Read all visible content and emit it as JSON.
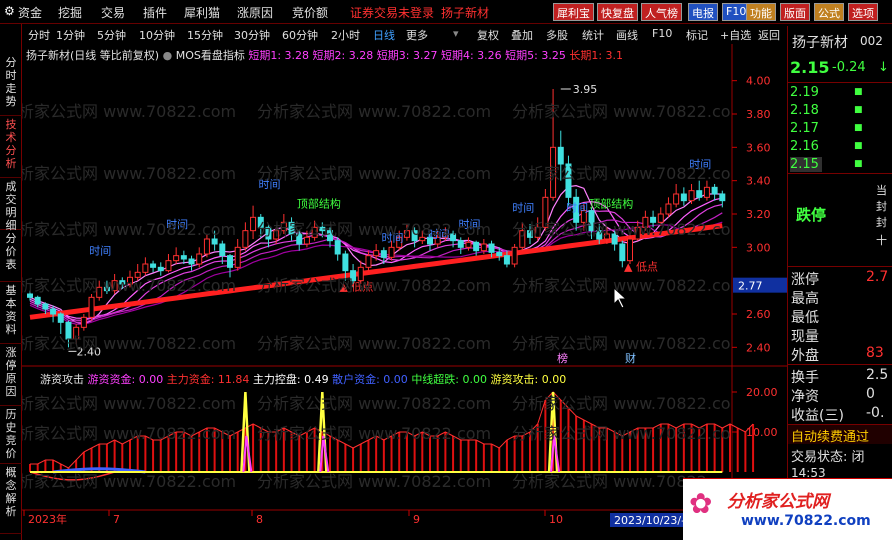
{
  "menubar": {
    "items": [
      "资金",
      "挖掘",
      "交易",
      "插件",
      "犀利猫",
      "涨原因",
      "竞价额"
    ],
    "warning": "证券交易未登录",
    "stock_name": "扬子新材",
    "buttons": [
      "犀利宝",
      "快复盘",
      "人气榜",
      "电报",
      "F10",
      "功能",
      "版面",
      "公式",
      "选项"
    ],
    "button_colors": [
      "#c02020",
      "#c02020",
      "#c02020",
      "#2050c0",
      "#2050c0",
      "#c08020",
      "#c02020",
      "#c08020",
      "#c02020"
    ]
  },
  "left_icon": "settings-gear-icon",
  "side_tabs": [
    "分时走势",
    "技术分析",
    "成交明细",
    "分价表",
    "基本资料",
    "涨停原因",
    "历史竞价",
    "概念解析"
  ],
  "toolbar": {
    "periods": [
      "分时",
      "1分钟",
      "5分钟",
      "10分钟",
      "15分钟",
      "30分钟",
      "60分钟",
      "2小时",
      "日线",
      "更多"
    ],
    "selected": "日线",
    "tools": [
      "复权",
      "叠加",
      "多股",
      "统计",
      "画线",
      "F10",
      "标记",
      "+自选",
      "返回"
    ]
  },
  "main_legend": {
    "title": "扬子新材(日线 等比前复权)",
    "indicator": "MOS看盘指标",
    "items": [
      {
        "label": "短期1: 3.28",
        "color": "#ff40ff"
      },
      {
        "label": "短期2: 3.28",
        "color": "#ff40ff"
      },
      {
        "label": "短期3: 3.27",
        "color": "#ff40ff"
      },
      {
        "label": "短期4: 3.26",
        "color": "#ff40ff"
      },
      {
        "label": "短期5: 3.25",
        "color": "#ff40ff"
      },
      {
        "label": "长期1: 3.1",
        "color": "#ff3030"
      }
    ]
  },
  "price_axis": [
    "4.00",
    "3.80",
    "3.60",
    "3.40",
    "3.20",
    "3.00",
    "2.60",
    "2.40"
  ],
  "current_price_tag": "2.77",
  "annotations": {
    "high": "3.95",
    "low": "2.40",
    "shijian": "时间",
    "dingbu": "顶部结构",
    "didian": "低点",
    "bang": "榜",
    "cai": "财"
  },
  "sub_legend": {
    "title": "游资攻击",
    "items": [
      {
        "label": "游资资金: 0.00",
        "color": "#ff40ff"
      },
      {
        "label": "主力资金: 11.84",
        "color": "#ff3030"
      },
      {
        "label": "主力控盘: 0.49",
        "color": "#ffffff"
      },
      {
        "label": "散户资金: 0.00",
        "color": "#4060ff"
      },
      {
        "label": "中线超跌: 0.00",
        "color": "#40ff40"
      },
      {
        "label": "游资攻击: 0.00",
        "color": "#ffff40"
      }
    ]
  },
  "sub_axis": [
    "20.00",
    "10.00"
  ],
  "date_axis": [
    "2023年",
    "7",
    "8",
    "9",
    "10"
  ],
  "date_tag": "2023/10/23/-",
  "watermark_text": "分析家公式网 www.70822.com",
  "right_panel": {
    "name": "扬子新材",
    "code": "002",
    "price": "2.15",
    "change": "-0.24",
    "change_arrow": "↓",
    "book": [
      "2.19",
      "2.18",
      "2.17",
      "2.16",
      "2.15"
    ],
    "limit_status": "跌停",
    "side_glyphs": [
      "当",
      "封",
      "封",
      "十"
    ],
    "fields": [
      {
        "label": "涨停",
        "value": "2.7"
      },
      {
        "label": "最高",
        "value": ""
      },
      {
        "label": "最低",
        "value": ""
      },
      {
        "label": "现量",
        "value": ""
      },
      {
        "label": "外盘",
        "value": "83"
      },
      {
        "label": "换手",
        "value": "2.5"
      },
      {
        "label": "净资",
        "value": "0"
      },
      {
        "label": "收益(三)",
        "value": "-0."
      }
    ],
    "notice": "自动续费通过",
    "trade_status": "交易状态: 闭",
    "time": "14:53"
  },
  "logo": {
    "title": "分析家公式网",
    "url": "www.70822.com"
  },
  "chart_data": {
    "type": "candlestick",
    "price_ylim": [
      2.3,
      4.1
    ],
    "candles": [
      {
        "o": 2.72,
        "c": 2.7,
        "h": 2.74,
        "l": 2.68
      },
      {
        "o": 2.7,
        "c": 2.66,
        "h": 2.71,
        "l": 2.64
      },
      {
        "o": 2.66,
        "c": 2.63,
        "h": 2.67,
        "l": 2.6
      },
      {
        "o": 2.63,
        "c": 2.6,
        "h": 2.65,
        "l": 2.55
      },
      {
        "o": 2.6,
        "c": 2.55,
        "h": 2.61,
        "l": 2.48
      },
      {
        "o": 2.55,
        "c": 2.45,
        "h": 2.56,
        "l": 2.4
      },
      {
        "o": 2.45,
        "c": 2.52,
        "h": 2.54,
        "l": 2.42
      },
      {
        "o": 2.52,
        "c": 2.58,
        "h": 2.6,
        "l": 2.5
      },
      {
        "o": 2.58,
        "c": 2.7,
        "h": 2.72,
        "l": 2.56
      },
      {
        "o": 2.7,
        "c": 2.76,
        "h": 2.8,
        "l": 2.68
      },
      {
        "o": 2.76,
        "c": 2.74,
        "h": 2.8,
        "l": 2.72
      },
      {
        "o": 2.74,
        "c": 2.8,
        "h": 2.84,
        "l": 2.72
      },
      {
        "o": 2.8,
        "c": 2.78,
        "h": 2.82,
        "l": 2.75
      },
      {
        "o": 2.78,
        "c": 2.82,
        "h": 2.86,
        "l": 2.76
      },
      {
        "o": 2.82,
        "c": 2.85,
        "h": 2.9,
        "l": 2.8
      },
      {
        "o": 2.85,
        "c": 2.9,
        "h": 2.94,
        "l": 2.83
      },
      {
        "o": 2.9,
        "c": 2.88,
        "h": 2.92,
        "l": 2.85
      },
      {
        "o": 2.88,
        "c": 2.86,
        "h": 2.91,
        "l": 2.83
      },
      {
        "o": 2.86,
        "c": 2.92,
        "h": 2.96,
        "l": 2.85
      },
      {
        "o": 2.92,
        "c": 2.95,
        "h": 3.0,
        "l": 2.9
      },
      {
        "o": 2.95,
        "c": 2.93,
        "h": 2.98,
        "l": 2.9
      },
      {
        "o": 2.93,
        "c": 2.9,
        "h": 2.95,
        "l": 2.86
      },
      {
        "o": 2.9,
        "c": 2.96,
        "h": 3.0,
        "l": 2.88
      },
      {
        "o": 2.96,
        "c": 3.05,
        "h": 3.08,
        "l": 2.94
      },
      {
        "o": 3.05,
        "c": 3.02,
        "h": 3.1,
        "l": 2.98
      },
      {
        "o": 3.02,
        "c": 2.95,
        "h": 3.04,
        "l": 2.9
      },
      {
        "o": 2.95,
        "c": 2.88,
        "h": 2.96,
        "l": 2.82
      },
      {
        "o": 2.88,
        "c": 3.0,
        "h": 3.05,
        "l": 2.86
      },
      {
        "o": 3.0,
        "c": 3.1,
        "h": 3.15,
        "l": 2.98
      },
      {
        "o": 3.1,
        "c": 3.18,
        "h": 3.25,
        "l": 3.05
      },
      {
        "o": 3.18,
        "c": 3.12,
        "h": 3.2,
        "l": 3.06
      },
      {
        "o": 3.12,
        "c": 3.05,
        "h": 3.14,
        "l": 3.0
      },
      {
        "o": 3.05,
        "c": 3.1,
        "h": 3.12,
        "l": 3.02
      },
      {
        "o": 3.1,
        "c": 3.15,
        "h": 3.2,
        "l": 3.08
      },
      {
        "o": 3.15,
        "c": 3.08,
        "h": 3.18,
        "l": 3.04
      },
      {
        "o": 3.08,
        "c": 3.02,
        "h": 3.1,
        "l": 2.98
      },
      {
        "o": 3.02,
        "c": 3.06,
        "h": 3.1,
        "l": 3.0
      },
      {
        "o": 3.06,
        "c": 3.12,
        "h": 3.16,
        "l": 3.04
      },
      {
        "o": 3.12,
        "c": 3.1,
        "h": 3.15,
        "l": 3.06
      },
      {
        "o": 3.1,
        "c": 3.04,
        "h": 3.12,
        "l": 3.0
      },
      {
        "o": 3.04,
        "c": 2.96,
        "h": 3.06,
        "l": 2.92
      },
      {
        "o": 2.96,
        "c": 2.86,
        "h": 2.98,
        "l": 2.8
      },
      {
        "o": 2.86,
        "c": 2.8,
        "h": 2.9,
        "l": 2.76
      },
      {
        "o": 2.8,
        "c": 2.88,
        "h": 2.92,
        "l": 2.78
      },
      {
        "o": 2.88,
        "c": 2.95,
        "h": 2.98,
        "l": 2.86
      },
      {
        "o": 2.95,
        "c": 2.98,
        "h": 3.02,
        "l": 2.92
      },
      {
        "o": 2.98,
        "c": 2.94,
        "h": 3.0,
        "l": 2.9
      },
      {
        "o": 2.94,
        "c": 3.0,
        "h": 3.04,
        "l": 2.92
      },
      {
        "o": 3.0,
        "c": 3.06,
        "h": 3.1,
        "l": 2.98
      },
      {
        "o": 3.06,
        "c": 3.1,
        "h": 3.14,
        "l": 3.04
      },
      {
        "o": 3.1,
        "c": 3.04,
        "h": 3.12,
        "l": 3.0
      },
      {
        "o": 3.04,
        "c": 3.06,
        "h": 3.1,
        "l": 3.02
      },
      {
        "o": 3.06,
        "c": 3.02,
        "h": 3.08,
        "l": 2.98
      },
      {
        "o": 3.02,
        "c": 3.06,
        "h": 3.1,
        "l": 3.0
      },
      {
        "o": 3.06,
        "c": 3.08,
        "h": 3.12,
        "l": 3.04
      },
      {
        "o": 3.08,
        "c": 3.04,
        "h": 3.1,
        "l": 3.0
      },
      {
        "o": 3.04,
        "c": 3.0,
        "h": 3.06,
        "l": 2.96
      },
      {
        "o": 3.0,
        "c": 3.03,
        "h": 3.06,
        "l": 2.98
      },
      {
        "o": 3.03,
        "c": 2.98,
        "h": 3.04,
        "l": 2.95
      },
      {
        "o": 2.98,
        "c": 3.02,
        "h": 3.05,
        "l": 2.96
      },
      {
        "o": 3.02,
        "c": 2.97,
        "h": 3.04,
        "l": 2.94
      },
      {
        "o": 2.97,
        "c": 2.95,
        "h": 3.0,
        "l": 2.92
      },
      {
        "o": 2.95,
        "c": 2.9,
        "h": 2.98,
        "l": 2.88
      },
      {
        "o": 2.9,
        "c": 3.0,
        "h": 3.02,
        "l": 2.88
      },
      {
        "o": 3.0,
        "c": 3.1,
        "h": 3.15,
        "l": 2.98
      },
      {
        "o": 3.1,
        "c": 3.06,
        "h": 3.14,
        "l": 3.02
      },
      {
        "o": 3.06,
        "c": 3.12,
        "h": 3.18,
        "l": 3.04
      },
      {
        "o": 3.12,
        "c": 3.3,
        "h": 3.35,
        "l": 3.1
      },
      {
        "o": 3.3,
        "c": 3.6,
        "h": 3.95,
        "l": 3.28
      },
      {
        "o": 3.6,
        "c": 3.5,
        "h": 3.7,
        "l": 3.4
      },
      {
        "o": 3.5,
        "c": 3.3,
        "h": 3.55,
        "l": 3.25
      },
      {
        "o": 3.3,
        "c": 3.15,
        "h": 3.35,
        "l": 3.1
      },
      {
        "o": 3.15,
        "c": 3.22,
        "h": 3.26,
        "l": 3.1
      },
      {
        "o": 3.22,
        "c": 3.1,
        "h": 3.24,
        "l": 3.05
      },
      {
        "o": 3.1,
        "c": 3.05,
        "h": 3.14,
        "l": 3.02
      },
      {
        "o": 3.05,
        "c": 3.08,
        "h": 3.12,
        "l": 3.02
      },
      {
        "o": 3.08,
        "c": 3.02,
        "h": 3.1,
        "l": 2.98
      },
      {
        "o": 3.02,
        "c": 2.92,
        "h": 3.04,
        "l": 2.88
      },
      {
        "o": 2.92,
        "c": 3.05,
        "h": 3.08,
        "l": 2.9
      },
      {
        "o": 3.05,
        "c": 3.12,
        "h": 3.16,
        "l": 3.04
      },
      {
        "o": 3.12,
        "c": 3.18,
        "h": 3.22,
        "l": 3.1
      },
      {
        "o": 3.18,
        "c": 3.15,
        "h": 3.22,
        "l": 3.12
      },
      {
        "o": 3.15,
        "c": 3.2,
        "h": 3.24,
        "l": 3.13
      },
      {
        "o": 3.2,
        "c": 3.26,
        "h": 3.3,
        "l": 3.18
      },
      {
        "o": 3.26,
        "c": 3.32,
        "h": 3.38,
        "l": 3.24
      },
      {
        "o": 3.32,
        "c": 3.28,
        "h": 3.36,
        "l": 3.25
      },
      {
        "o": 3.28,
        "c": 3.34,
        "h": 3.38,
        "l": 3.26
      },
      {
        "o": 3.34,
        "c": 3.3,
        "h": 3.4,
        "l": 3.28
      },
      {
        "o": 3.3,
        "c": 3.36,
        "h": 3.4,
        "l": 3.28
      },
      {
        "o": 3.36,
        "c": 3.32,
        "h": 3.38,
        "l": 3.28
      },
      {
        "o": 3.32,
        "c": 3.28,
        "h": 3.34,
        "l": 3.24
      }
    ],
    "sub_ylim": [
      -3,
      22
    ],
    "main_fund": [
      2,
      2,
      3,
      3,
      2,
      1,
      3,
      5,
      6,
      7,
      7,
      8,
      7,
      8,
      9,
      9,
      8,
      8,
      9,
      10,
      10,
      9,
      10,
      11,
      11,
      10,
      9,
      10,
      11,
      12,
      11,
      10,
      10,
      11,
      10,
      9,
      10,
      11,
      10,
      9,
      8,
      7,
      6,
      7,
      8,
      9,
      8,
      9,
      10,
      10,
      9,
      10,
      9,
      9,
      10,
      9,
      8,
      8,
      8,
      7,
      7,
      6,
      8,
      9,
      9,
      10,
      12,
      18,
      20,
      18,
      16,
      14,
      13,
      12,
      11,
      11,
      10,
      9,
      10,
      11,
      11,
      11,
      12,
      12,
      11,
      12,
      12,
      11,
      12,
      12,
      11,
      12,
      11,
      10,
      12
    ],
    "attack": [
      0,
      0,
      0,
      0,
      0,
      0,
      0,
      0,
      0,
      0,
      0,
      0,
      0,
      0,
      0,
      0,
      0,
      0,
      0,
      0,
      0,
      0,
      0,
      0,
      0,
      0,
      0,
      0,
      0,
      0,
      0,
      0,
      0,
      0,
      0,
      0,
      0,
      0,
      0,
      0,
      0,
      0,
      0,
      0,
      0,
      0,
      0,
      0,
      0,
      0,
      0,
      0,
      0,
      0,
      0,
      0,
      0,
      0,
      0,
      0,
      0,
      0,
      0,
      0,
      0,
      0,
      0,
      0,
      0,
      0,
      0,
      0,
      0,
      0,
      0,
      0,
      0,
      0,
      0,
      0,
      0,
      0,
      0,
      0,
      0,
      0,
      0,
      0,
      0,
      0,
      0,
      0,
      0,
      0,
      0
    ],
    "attack_spikes": [
      {
        "i": 28,
        "v": 20
      },
      {
        "i": 38,
        "v": 20
      },
      {
        "i": 68,
        "v": 20
      }
    ]
  }
}
